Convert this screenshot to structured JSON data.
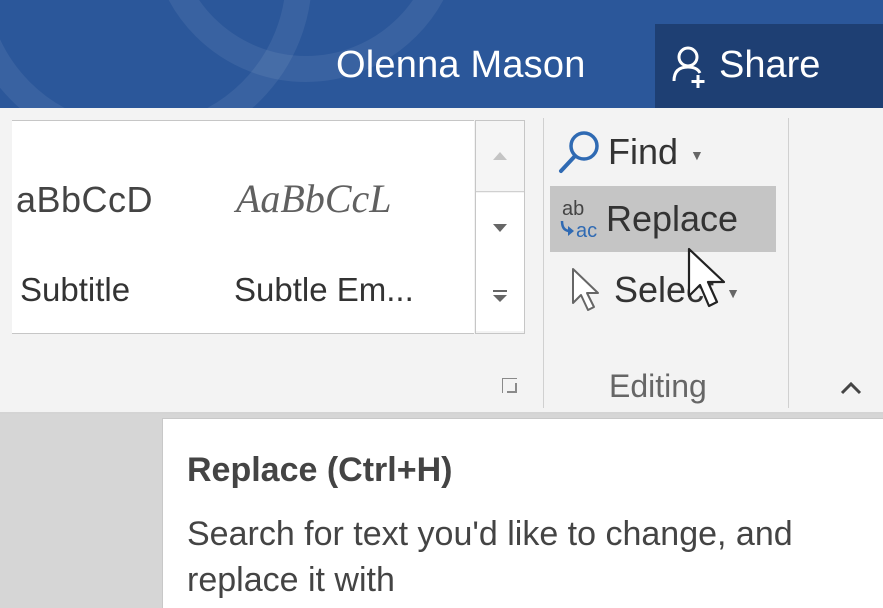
{
  "title_bar": {
    "user_name": "Olenna Mason",
    "share_label": "Share",
    "share_icon": "person-add-icon",
    "accent_color": "#2b579a"
  },
  "styles_gallery": {
    "previews": [
      {
        "sample": "aBbCcD",
        "name": "Subtitle"
      },
      {
        "sample": "AaBbCcL",
        "name": "Subtle Em..."
      }
    ]
  },
  "editing_group": {
    "label": "Editing",
    "find": {
      "label": "Find",
      "icon": "magnifier-icon"
    },
    "replace": {
      "label": "Replace",
      "icon": "replace-ab-ac-icon",
      "icon_top": "ab",
      "icon_bottom": "ac",
      "state": "hovered"
    },
    "select": {
      "label": "Select",
      "icon": "arrow-cursor-icon"
    }
  },
  "tooltip": {
    "title": "Replace (Ctrl+H)",
    "description": "Search for text you'd like to change, and replace it with"
  }
}
